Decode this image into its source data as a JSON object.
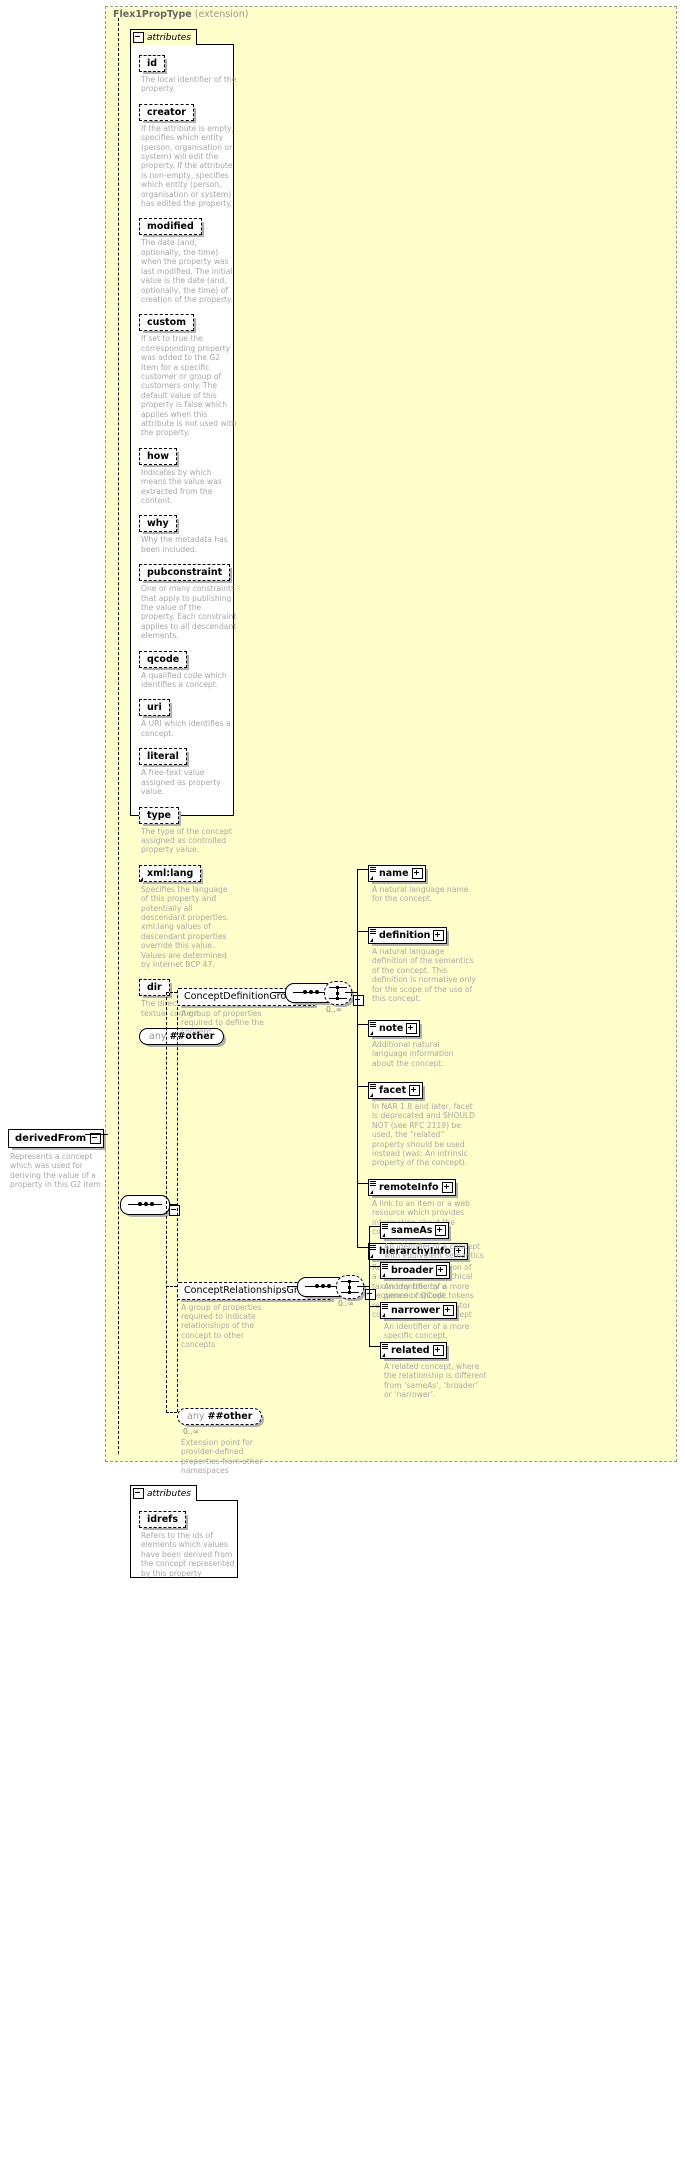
{
  "diagram": {
    "type": "xsd-schema-diagram",
    "extension_panel": {
      "type_name": "Flex1PropType",
      "qualifier": "(extension)"
    },
    "root_element": {
      "name": "derivedFrom",
      "doc": "Represents a concept which was used for deriving the value of a property in this G2 item",
      "toggle": "minus"
    },
    "attributes_group_label": "attributes",
    "attributes": [
      {
        "name": "id",
        "doc": "The local identifier of the property."
      },
      {
        "name": "creator",
        "doc": "If the attribute is empty, specifies which entity (person, organisation or system) will edit the property. If the attribute is non-empty, specifies which entity (person, organisation or system) has edited the property."
      },
      {
        "name": "modified",
        "doc": "The date (and, optionally, the time) when the property was last modified. The initial value is the date (and, optionally, the time) of creation of the property."
      },
      {
        "name": "custom",
        "doc": "If set to true the corresponding property was added to the G2 Item for a specific customer or group of customers only. The default value of this property is false which applies when this attribute is not used with the property."
      },
      {
        "name": "how",
        "doc": "Indicates by which means the value was extracted from the content."
      },
      {
        "name": "why",
        "doc": "Why the metadata has been included."
      },
      {
        "name": "pubconstraint",
        "doc": "One or many constraints that apply to publishing the value of the property. Each constraint applies to all descendant elements."
      },
      {
        "name": "qcode",
        "doc": "A qualified code which identifies a concept."
      },
      {
        "name": "uri",
        "doc": "A URI which identifies a concept."
      },
      {
        "name": "literal",
        "doc": "A free-text value assigned as property value."
      },
      {
        "name": "type",
        "doc": "The type of the concept assigned as controlled property value."
      },
      {
        "name": "xmllang",
        "label": "xml:lang",
        "doc": "Specifies the language of this property and potentially all descendant properties. xml:lang values of descendant properties override this value. Values are determined by Internet BCP 47."
      },
      {
        "name": "dir",
        "doc": "The directionality of textual content."
      }
    ],
    "any_other": {
      "prefix": "any",
      "label": "##other"
    },
    "groups": [
      {
        "name": "ConceptDefinitionGroup",
        "doc": "A group of properties required to define the concept",
        "cardinality": "0..∞",
        "children": [
          {
            "name": "name",
            "doc": "A natural language name for the concept."
          },
          {
            "name": "definition",
            "doc": "A natural language definition of the semantics of the concept. This definition is normative only for the scope of the use of this concept."
          },
          {
            "name": "note",
            "doc": "Additional natural language information about the concept."
          },
          {
            "name": "facet",
            "doc": "In NAR 1.8 and later, facet is deprecated and SHOULD NOT (see RFC 2119) be used, the “related” property should be used instead (was: An intrinsic property of the concept)."
          },
          {
            "name": "remoteInfo",
            "doc": "A link to an item or a web resource which provides information about the concept"
          },
          {
            "name": "hierarchyInfo",
            "doc": "Represents the position of a concept in a hierarchical taxonomy tree by a sequence of QCode tokens representing the ancestor concepts and this concept"
          }
        ]
      },
      {
        "name": "ConceptRelationshipsGroup",
        "doc": "A group of properties required to indicate relationships of the concept to other concepts",
        "cardinality": "0..∞",
        "children": [
          {
            "name": "sameAs",
            "doc": "An identifier of a concept with equivalent semantics"
          },
          {
            "name": "broader",
            "doc": "An identifier of a more generic concept."
          },
          {
            "name": "narrower",
            "doc": "An identifier of a more specific concept."
          },
          {
            "name": "related",
            "doc": "A related concept, where the relationship is different from ‘sameAs’, ‘broader’ or ‘narrower’."
          }
        ]
      }
    ],
    "any_extension": {
      "prefix": "any",
      "label": "##other",
      "cardinality": "0..∞",
      "doc": "Extension point for provider-defined properties from other namespaces"
    },
    "bottom_attributes": {
      "group_label": "attributes",
      "items": [
        {
          "name": "idrefs",
          "doc": "Refers to the ids of elements which values have been derived from the concept represented by this property"
        }
      ]
    },
    "colors": {
      "panel_bg": "#ffffcc",
      "box_bg": "#ffffff",
      "doc_text": "#a8a8a8",
      "line": "#000000",
      "shadow": "#b0b0b0"
    }
  }
}
